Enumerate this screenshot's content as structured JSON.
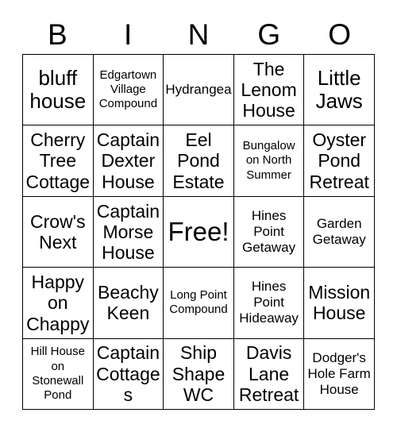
{
  "card": {
    "header_letters": [
      "B",
      "I",
      "N",
      "G",
      "O"
    ],
    "rows": [
      [
        {
          "text": "bluff house",
          "size": "fs-lg"
        },
        {
          "text": "Edgartown Village Compound",
          "size": "fs-xs"
        },
        {
          "text": "Hydrangea",
          "size": "fs-sm"
        },
        {
          "text": "The Lenom House",
          "size": "fs-md"
        },
        {
          "text": "Little Jaws",
          "size": "fs-lg"
        }
      ],
      [
        {
          "text": "Cherry Tree Cottage",
          "size": "fs-md"
        },
        {
          "text": "Captain Dexter House",
          "size": "fs-md"
        },
        {
          "text": "Eel Pond Estate",
          "size": "fs-md"
        },
        {
          "text": "Bungalow on North Summer",
          "size": "fs-xs"
        },
        {
          "text": "Oyster Pond Retreat",
          "size": "fs-md"
        }
      ],
      [
        {
          "text": "Crow's Next",
          "size": "fs-md"
        },
        {
          "text": "Captain Morse House",
          "size": "fs-md"
        },
        {
          "text": "Free!",
          "size": "fs-xl"
        },
        {
          "text": "Hines Point Getaway",
          "size": "fs-sm"
        },
        {
          "text": "Garden Getaway",
          "size": "fs-sm"
        }
      ],
      [
        {
          "text": "Happy on Chappy",
          "size": "fs-md"
        },
        {
          "text": "Beachy Keen",
          "size": "fs-md"
        },
        {
          "text": "Long Point Compound",
          "size": "fs-xs"
        },
        {
          "text": "Hines Point Hideaway",
          "size": "fs-sm"
        },
        {
          "text": "Mission House",
          "size": "fs-md"
        }
      ],
      [
        {
          "text": "Hill House on Stonewall Pond",
          "size": "fs-xs"
        },
        {
          "text": "Captain Cottages",
          "size": "fs-md"
        },
        {
          "text": "Ship Shape WC",
          "size": "fs-md"
        },
        {
          "text": "Davis Lane Retreat",
          "size": "fs-md"
        },
        {
          "text": "Dodger's Hole Farm House",
          "size": "fs-sm"
        }
      ]
    ]
  }
}
